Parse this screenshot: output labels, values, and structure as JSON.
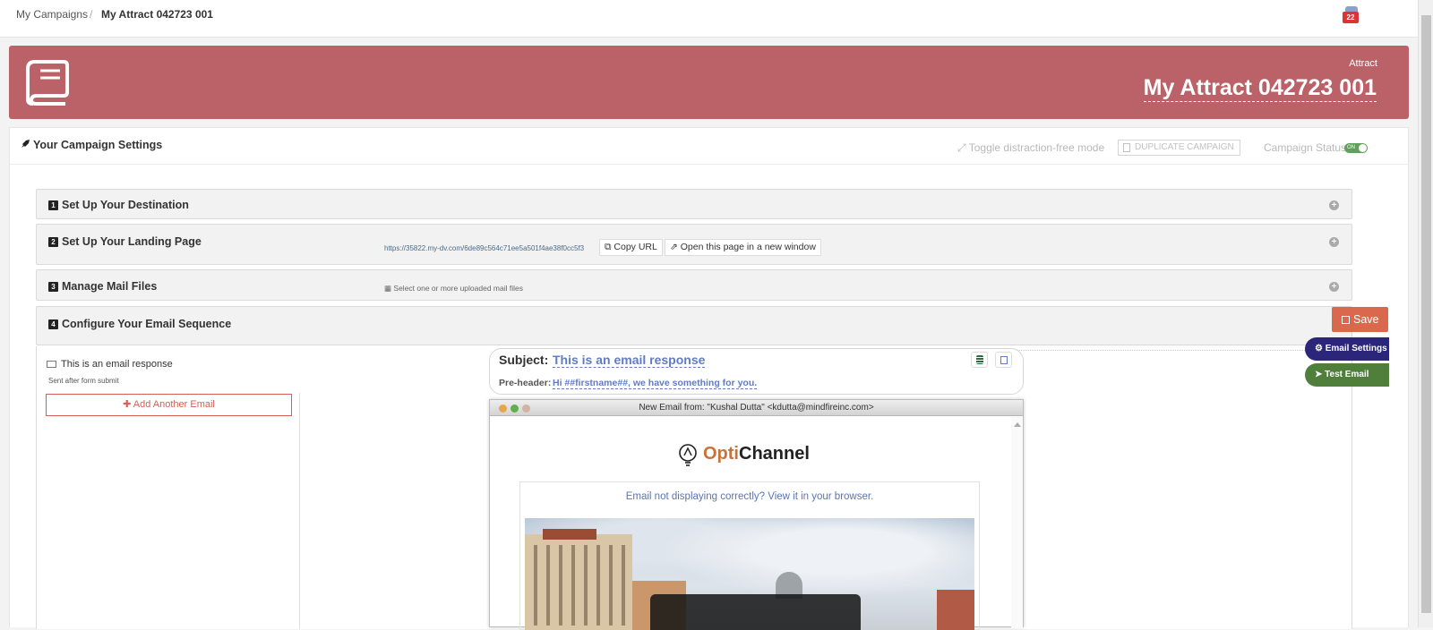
{
  "breadcrumb": {
    "parent": "My Campaigns",
    "separator": "/",
    "current": "My Attract 042723 001"
  },
  "notifications": {
    "count": "22"
  },
  "header": {
    "campaign_type": "Attract",
    "campaign_name": "My Attract 042723 001",
    "color": "#bb6168"
  },
  "settings_bar": {
    "title": "Your Campaign Settings",
    "toggle_distraction": "Toggle distraction-free mode",
    "duplicate": "DUPLICATE CAMPAIGN",
    "status_label": "Campaign Status:",
    "status_switch": "ON"
  },
  "sections": [
    {
      "number": "1",
      "label": "Set Up Your Destination"
    },
    {
      "number": "2",
      "label": "Set Up Your Landing Page",
      "url": "https://35822.my-dv.com/6de89c564c71ee5a501f4ae38f0cc5f3",
      "copy_url": "Copy URL",
      "open_window": "Open this page in a new window"
    },
    {
      "number": "3",
      "label": "Manage Mail Files",
      "hint": "Select one or more uploaded mail files"
    },
    {
      "number": "4",
      "label": "Configure Your Email Sequence"
    }
  ],
  "email_list": {
    "item_title": "This is an email response",
    "item_trigger": "Sent after form submit",
    "add_button": "Add Another Email"
  },
  "email_editor": {
    "subject_label": "Subject:",
    "subject_value": "This is an email response",
    "preheader_label": "Pre-header:",
    "preheader_value": "Hi ##firstname##, we have something for you.",
    "window_title": "New Email from: \"Kushal Dutta\" <kdutta@mindfireinc.com>",
    "brand_part1": "Opti",
    "brand_part2": "Channel",
    "view_in_browser": "Email not displaying correctly? View it in your browser."
  },
  "actions": {
    "save": "Save",
    "email_settings": "Email Settings",
    "test_email": "Test Email"
  },
  "icons": [
    "book-icon",
    "rocket-icon",
    "expand-icon",
    "copy-icon",
    "external-link-icon",
    "grid-icon",
    "plus-circle-icon",
    "envelope-icon",
    "plus-icon",
    "database-icon",
    "floppy-disk-icon",
    "cogs-icon",
    "paper-plane-icon",
    "bell-icon"
  ],
  "colors": {
    "accent_red": "#d9684c",
    "link_blue": "#5f7cc4",
    "email_settings": "#2b2679",
    "test_email": "#4f7f3a",
    "brand_orange": "#c9733b"
  }
}
